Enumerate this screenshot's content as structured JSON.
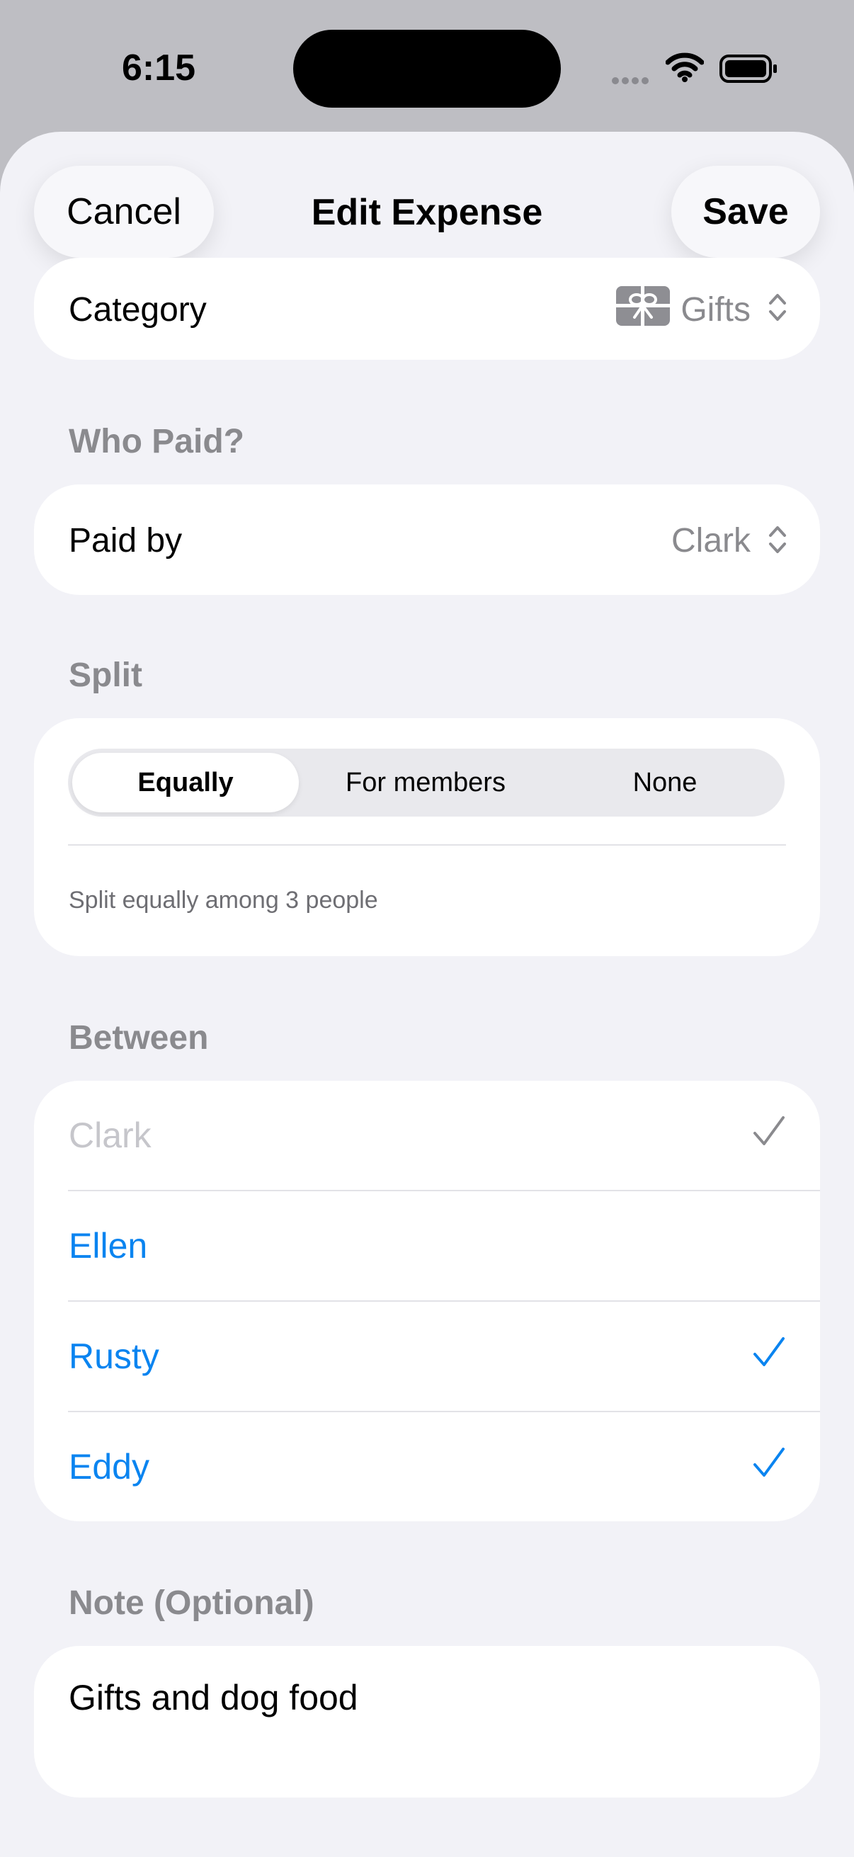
{
  "status_bar": {
    "time": "6:15"
  },
  "nav": {
    "cancel_label": "Cancel",
    "title": "Edit Expense",
    "save_label": "Save"
  },
  "category": {
    "label": "Category",
    "value": "Gifts",
    "icon": "gift-icon"
  },
  "who_paid": {
    "header": "Who Paid?",
    "label": "Paid by",
    "value": "Clark"
  },
  "split": {
    "header": "Split",
    "options": [
      "Equally",
      "For members",
      "None"
    ],
    "selected": "Equally",
    "description": "Split equally among 3 people"
  },
  "between": {
    "header": "Between",
    "members": [
      {
        "name": "Clark",
        "checked": true,
        "disabled": true
      },
      {
        "name": "Ellen",
        "checked": false,
        "disabled": false
      },
      {
        "name": "Rusty",
        "checked": true,
        "disabled": false
      },
      {
        "name": "Eddy",
        "checked": true,
        "disabled": false
      }
    ]
  },
  "note": {
    "header": "Note (Optional)",
    "value": "Gifts and dog food"
  },
  "colors": {
    "accent": "#0a84f0",
    "secondary_text": "#8a8a8e",
    "disabled_text": "#c6c6cb",
    "background": "#f2f2f7"
  }
}
